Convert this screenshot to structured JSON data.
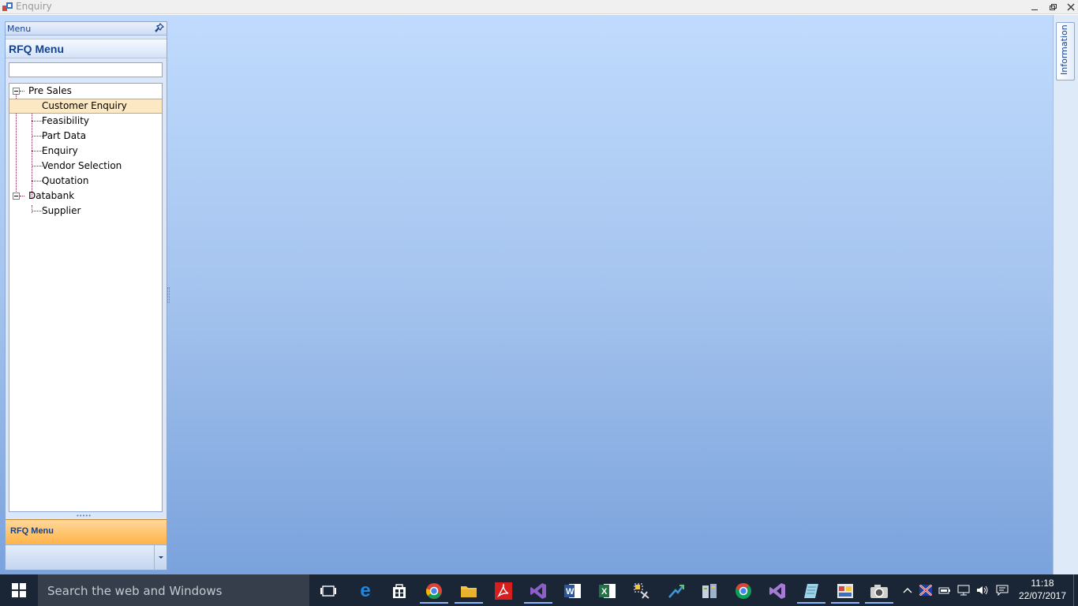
{
  "window": {
    "title": "Enquiry",
    "controls": [
      "minimize",
      "maximize",
      "close"
    ]
  },
  "left_panel": {
    "caption": "Menu",
    "group_title": "RFQ Menu",
    "search": {
      "value": "",
      "placeholder": ""
    },
    "tree": [
      {
        "label": "Pre Sales",
        "expanded": true,
        "children": [
          {
            "label": "Customer Enquiry",
            "selected": true
          },
          {
            "label": "Feasibility"
          },
          {
            "label": "Part Data"
          },
          {
            "label": "Enquiry"
          },
          {
            "label": "Vendor Selection"
          },
          {
            "label": "Quotation"
          }
        ]
      },
      {
        "label": "Databank",
        "expanded": true,
        "children": [
          {
            "label": "Supplier"
          }
        ]
      }
    ],
    "nav_button": "RFQ Menu"
  },
  "right_panel": {
    "tab_label": "Information"
  },
  "taskbar": {
    "search_placeholder": "Search the web and Windows",
    "apps": [
      "task-view",
      "edge",
      "store",
      "chrome",
      "file-explorer",
      "acrobat",
      "visual-studio",
      "word",
      "excel",
      "tools",
      "sharing",
      "sql-server",
      "chrome-alt",
      "visual-studio-alt",
      "notepad",
      "app-window",
      "camera"
    ],
    "time": "11:18",
    "date": "22/07/2017"
  },
  "colors": {
    "accent_blue": "#15428b",
    "selection": "#fce9c4",
    "nav_orange": "#ffb347",
    "taskbar": "#1a2535"
  }
}
